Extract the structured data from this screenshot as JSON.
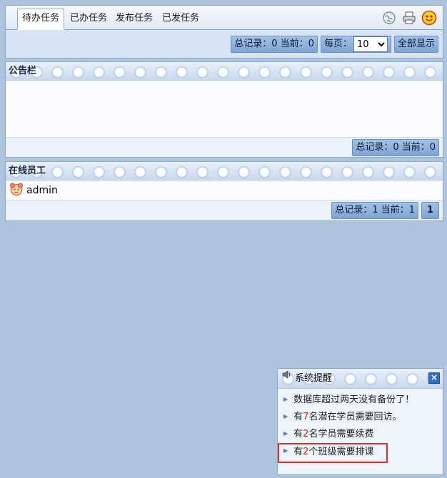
{
  "tabs": [
    "待办任务",
    "已办任务",
    "发布任务",
    "已发任务"
  ],
  "tab_icons": [
    "globe-icon",
    "printer-icon",
    "smiley-icon"
  ],
  "tasks_pager": {
    "total_label": "总记录：0 当前：0",
    "per_page_label": "每页：",
    "per_page_value": "10",
    "show_all_label": "全部显示"
  },
  "bulletin": {
    "title": "公告栏",
    "pager_label": "总记录：0 当前：0"
  },
  "staff": {
    "title": "在线员工",
    "users": [
      "admin"
    ],
    "pager_label": "总记录：1 当前：1",
    "page_number": "1"
  },
  "reminder": {
    "title": "系统提醒",
    "items": [
      {
        "before": "数据库超过两天没有备份了！",
        "num": "",
        "after": ""
      },
      {
        "before": "有",
        "num": "7",
        "after": "名潜在学员需要回访。"
      },
      {
        "before": "有",
        "num": "2",
        "after": "名学员需要续费"
      },
      {
        "before": "有",
        "num": "2",
        "after": "个班级需要排课"
      }
    ]
  },
  "colors": {
    "background": "#aec3dc",
    "button": "#8fb2e0",
    "alert_number": "#e0201b",
    "highlight": "#e32d2d"
  }
}
